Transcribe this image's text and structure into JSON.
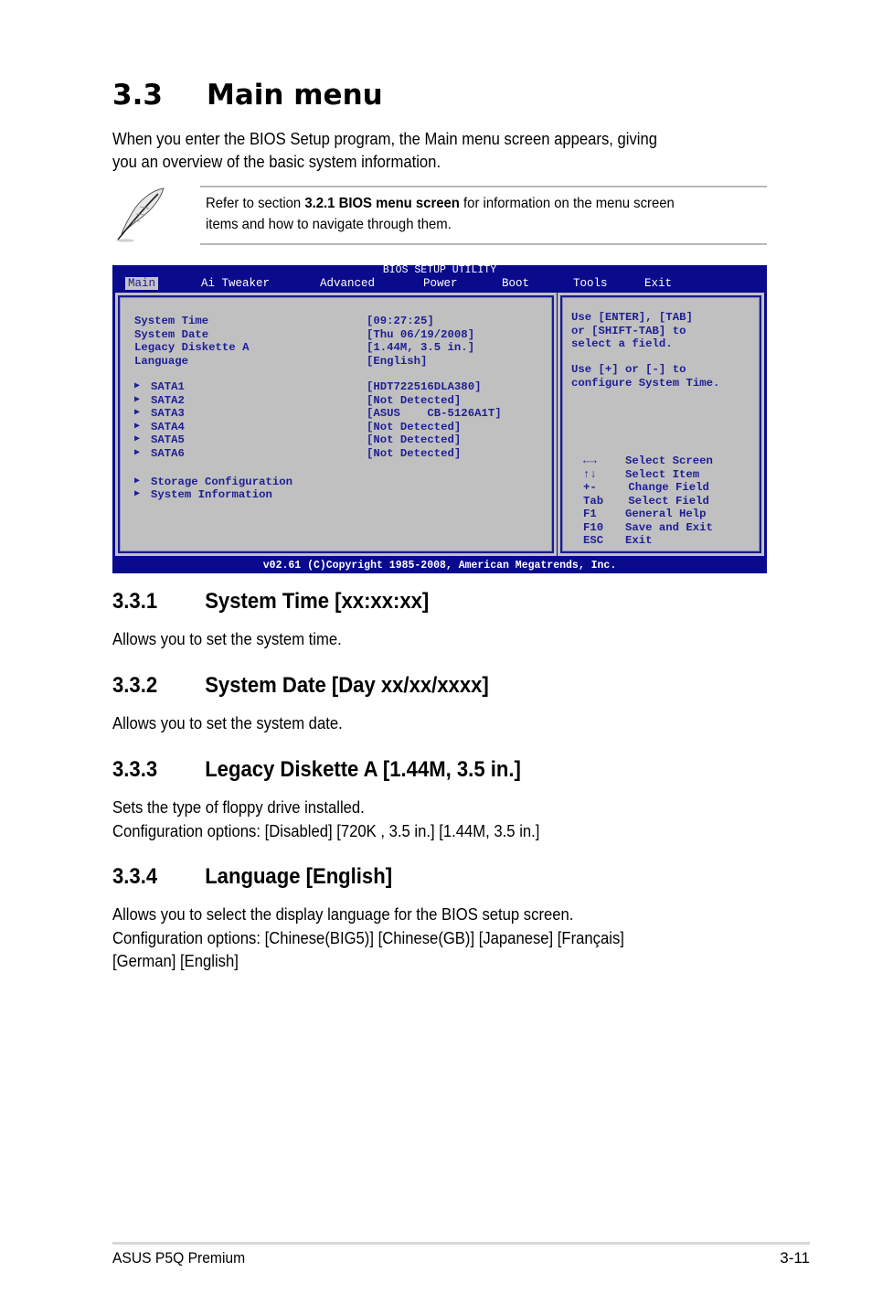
{
  "heading": {
    "number": "3.3",
    "title": "Main menu"
  },
  "intro": [
    "When you enter the BIOS Setup program, the Main menu screen appears, giving",
    "you an overview of the basic system information."
  ],
  "note": {
    "icon": "feather-quill-icon",
    "pre": "Refer to section ",
    "bold": "3.2.1 BIOS menu screen",
    "post": " for information on the menu screen",
    "line2": "items and how to navigate through them."
  },
  "bios": {
    "title": "BIOS SETUP UTILITY",
    "menus": [
      "Main",
      "Ai Tweaker",
      "Advanced",
      "Power",
      "Boot",
      "Tools",
      "Exit"
    ],
    "active_menu": "Main",
    "colors": {
      "frame": "#0a0a8c",
      "panel": "#c0c0c0",
      "text": "#1e1e96"
    },
    "fields": [
      {
        "label": "System Time",
        "value": "[09:27:25]"
      },
      {
        "label": "System Date",
        "value": "[Thu 06/19/2008]"
      },
      {
        "label": "Legacy Diskette A",
        "value": "[1.44M, 3.5 in.]"
      },
      {
        "label": "Language",
        "value": "[English]"
      }
    ],
    "sata": [
      {
        "label": "SATA1",
        "value": "[HDT722516DLA380]"
      },
      {
        "label": "SATA2",
        "value": "[Not Detected]"
      },
      {
        "label": "SATA3",
        "value": "[ASUS    CB-5126A1T]"
      },
      {
        "label": "SATA4",
        "value": "[Not Detected]"
      },
      {
        "label": "SATA5",
        "value": "[Not Detected]"
      },
      {
        "label": "SATA6",
        "value": "[Not Detected]"
      }
    ],
    "submenus": [
      "Storage Configuration",
      "System Information"
    ],
    "help": [
      "Use [ENTER], [TAB]",
      "or [SHIFT-TAB] to",
      "select a field.",
      "",
      "Use [+] or [-] to",
      "configure System Time."
    ],
    "keys": [
      {
        "key": "←→",
        "action": "Select Screen"
      },
      {
        "key": "↑↓",
        "action": "Select Item"
      },
      {
        "key": "+-",
        "action": " Change Field"
      },
      {
        "key": "Tab",
        "action": " Select Field"
      },
      {
        "key": "F1",
        "action": "General Help"
      },
      {
        "key": "F10",
        "action": "Save and Exit"
      },
      {
        "key": "ESC",
        "action": "Exit"
      }
    ],
    "footer": "v02.61 (C)Copyright 1985-2008, American Megatrends, Inc."
  },
  "sections": [
    {
      "number": "3.3.1",
      "title": "System Time [xx:xx:xx]",
      "body": [
        "Allows you to set the system time."
      ]
    },
    {
      "number": "3.3.2",
      "title": "System Date [Day xx/xx/xxxx]",
      "body": [
        "Allows you to set the system date."
      ]
    },
    {
      "number": "3.3.3",
      "title": "Legacy Diskette A [1.44M, 3.5 in.]",
      "body": [
        "Sets the type of floppy drive installed.",
        "Configuration options: [Disabled] [720K , 3.5 in.] [1.44M, 3.5 in.]"
      ]
    },
    {
      "number": "3.3.4",
      "title": "Language [English]",
      "body": [
        "Allows you to select the display language for the BIOS setup screen.",
        "Configuration options: [Chinese(BIG5)] [Chinese(GB)] [Japanese] [Français]",
        "[German] [English]"
      ]
    }
  ],
  "footer": {
    "product": "ASUS P5Q Premium",
    "page": "3-11"
  }
}
